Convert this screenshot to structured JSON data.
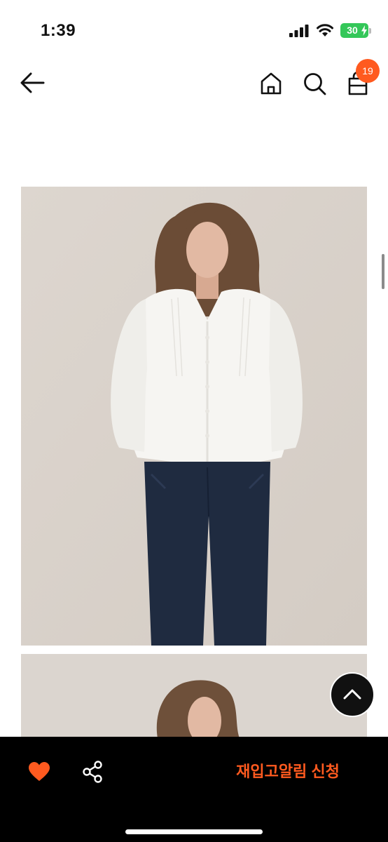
{
  "status_bar": {
    "time": "1:39",
    "battery_level": "30",
    "icons": [
      "signal-icon",
      "wifi-icon",
      "battery-icon",
      "charging-bolt-icon"
    ]
  },
  "nav_bar": {
    "icons": [
      "back-arrow-icon",
      "home-icon",
      "search-icon",
      "shopping-bag-icon"
    ],
    "cart_count": "19"
  },
  "product": {
    "images": [
      "product-photo-front",
      "product-photo-second"
    ]
  },
  "bottom_bar": {
    "icons": [
      "heart-icon",
      "share-icon"
    ],
    "restock_alert_label": "재입고알림 신청"
  },
  "colors": {
    "accent": "#ff5a1f",
    "bottom_bar": "#000000",
    "battery": "#34c759"
  }
}
